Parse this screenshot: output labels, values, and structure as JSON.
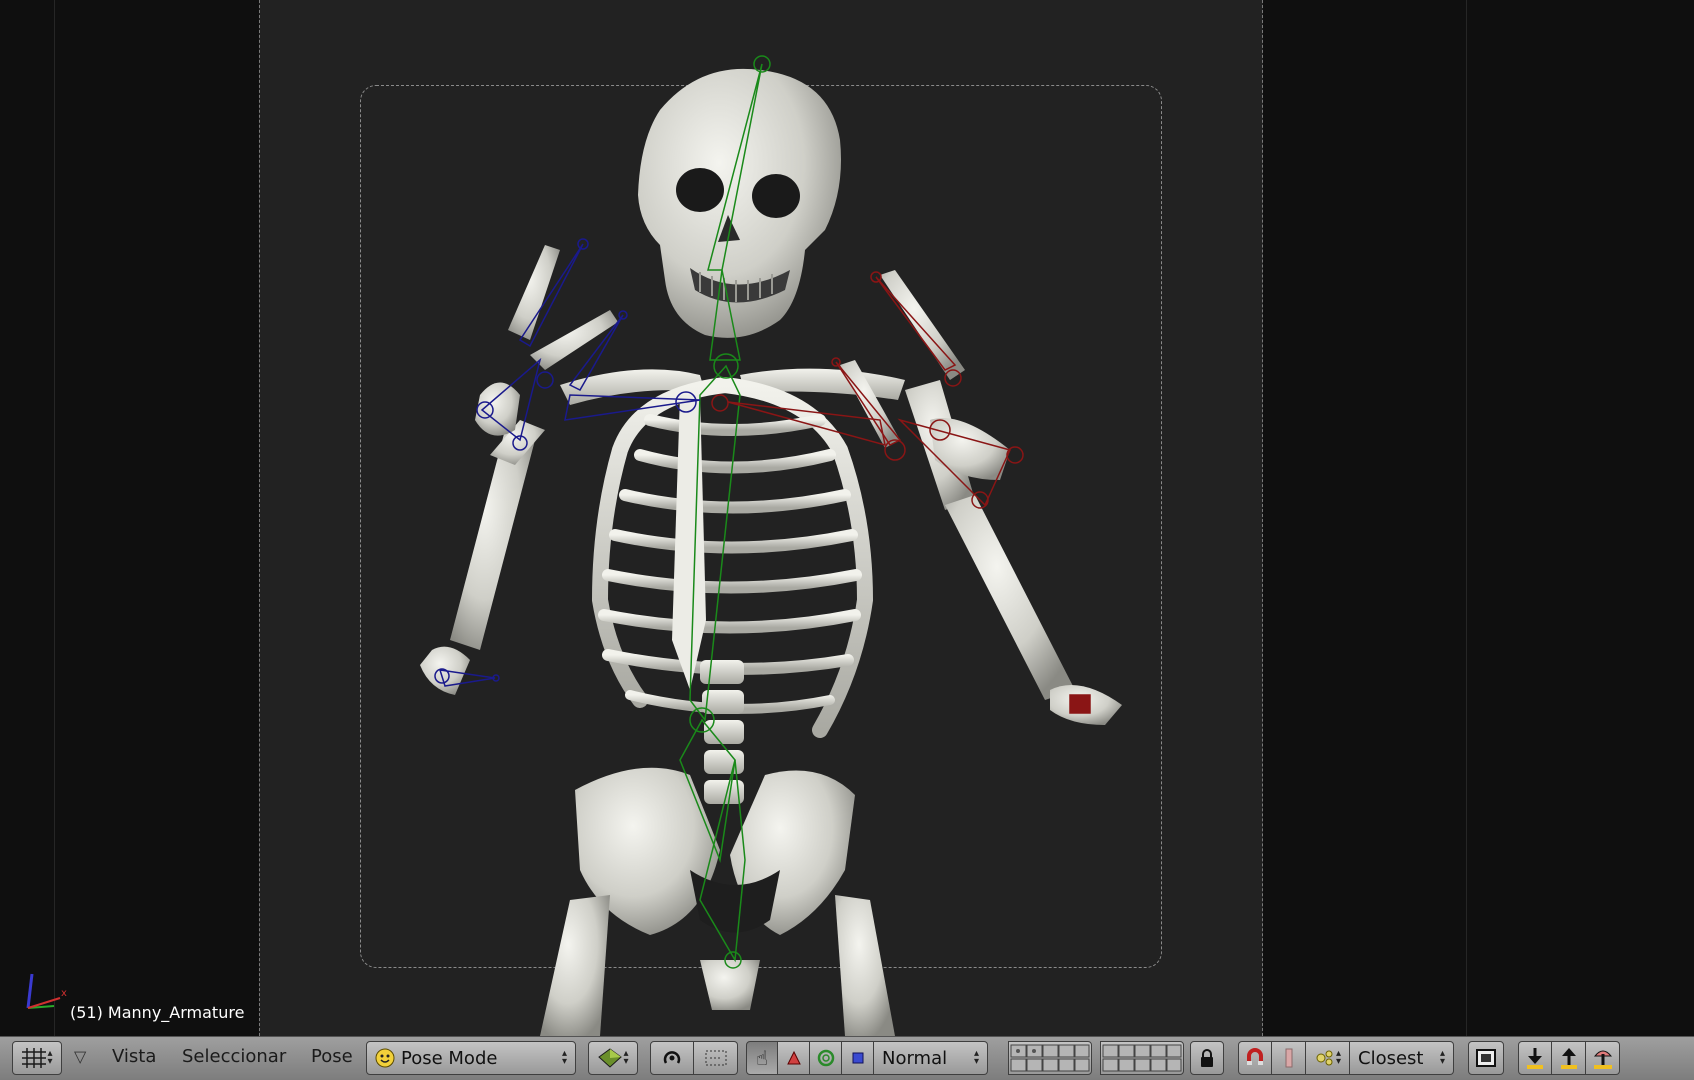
{
  "viewport": {
    "object_info": "(51) Manny_Armature"
  },
  "header": {
    "menus": [
      {
        "label": "Vista"
      },
      {
        "label": "Seleccionar"
      },
      {
        "label": "Pose"
      }
    ],
    "mode_dropdown": {
      "label": "Pose Mode",
      "icon": "pose-mode-icon"
    },
    "orientation_dropdown": {
      "label": "Normal"
    },
    "snap_target_dropdown": {
      "label": "Closest"
    }
  },
  "colors": {
    "header_bg": "#8f8f8f",
    "viewport_bg": "#222222",
    "bone_center": "#1a8a1a",
    "bone_left": "#1a1a8c",
    "bone_right": "#8a1515"
  }
}
